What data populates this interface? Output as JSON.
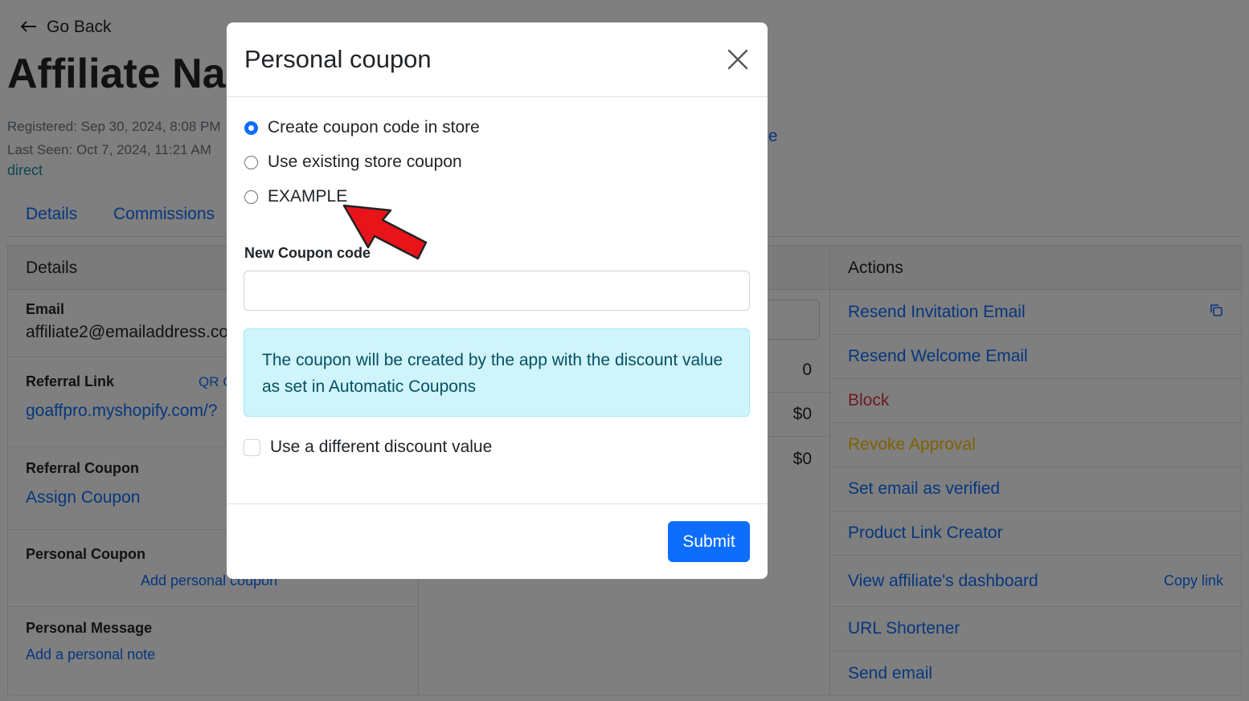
{
  "header": {
    "back_label": "Go Back",
    "title": "Affiliate Na"
  },
  "meta": {
    "registered": "Registered: Sep 30, 2024, 8:08 PM",
    "last_seen": "Last Seen: Oct 7, 2024, 11:21 AM",
    "source": "direct",
    "partial_link": "te"
  },
  "tabs": [
    "Details",
    "Commissions"
  ],
  "details": {
    "title": "Details",
    "email_label": "Email",
    "email_value": "affiliate2@emailaddress.co",
    "referral_link_label": "Referral Link",
    "qr_label": "QR C",
    "referral_link_value": "goaffpro.myshopify.com/?",
    "referral_coupon_label": "Referral Coupon",
    "assign_coupon": "Assign Coupon",
    "personal_coupon_label": "Personal Coupon",
    "add_personal_coupon": "Add personal coupon",
    "personal_message_label": "Personal Message",
    "add_note": "Add a personal note"
  },
  "stats": {
    "values": [
      "0",
      "$0",
      "$0"
    ]
  },
  "actions": {
    "title": "Actions",
    "items": [
      {
        "label": "Resend Invitation Email",
        "color": "#0d6efd"
      },
      {
        "label": "Resend Welcome Email",
        "color": "#0d6efd"
      },
      {
        "label": "Block",
        "color": "#dc3545"
      },
      {
        "label": "Revoke Approval",
        "color": "#ffc107"
      },
      {
        "label": "Set email as verified",
        "color": "#0d6efd"
      },
      {
        "label": "Product Link Creator",
        "color": "#0d6efd"
      },
      {
        "label": "View affiliate's dashboard",
        "color": "#0d6efd"
      },
      {
        "label": "URL Shortener",
        "color": "#0d6efd"
      },
      {
        "label": "Send email",
        "color": "#0d6efd"
      }
    ],
    "copy_link": "Copy link"
  },
  "modal": {
    "title": "Personal coupon",
    "options": [
      {
        "label": "Create coupon code in store",
        "checked": true
      },
      {
        "label": "Use existing store coupon",
        "checked": false
      },
      {
        "label": "EXAMPLE",
        "checked": false
      }
    ],
    "new_code_label": "New Coupon code",
    "new_code_value": "",
    "info": "The coupon will be created by the app with the discount value as set in Automatic Coupons",
    "different_value_label": "Use a different discount value",
    "submit_label": "Submit"
  },
  "colors": {
    "primary": "#0d6efd",
    "danger": "#dc3545",
    "warning": "#ffc107",
    "info_bg": "#cff4fc",
    "arrow": "#e8141a"
  }
}
